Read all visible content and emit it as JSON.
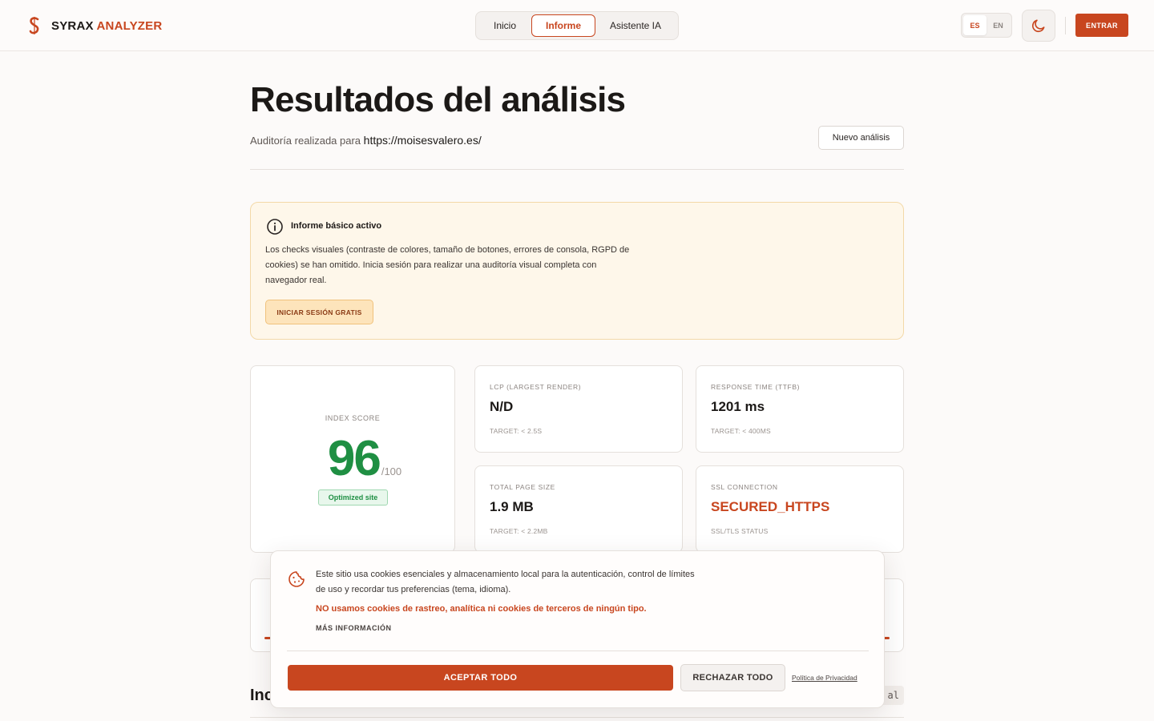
{
  "header": {
    "brand_primary": "SYRAX",
    "brand_accent": "ANALYZER",
    "nav": [
      {
        "label": "Inicio",
        "active": false
      },
      {
        "label": "Informe",
        "active": true
      },
      {
        "label": "Asistente IA",
        "active": false
      }
    ],
    "languages": [
      {
        "label": "ES",
        "active": true
      },
      {
        "label": "EN",
        "active": false
      }
    ],
    "theme_icon": "moon-icon",
    "login_label": "ENTRAR"
  },
  "main": {
    "title": "Resultados del análisis",
    "subtitle_prefix": "Auditoría realizada para",
    "audited_url": "https://moisesvalero.es/",
    "new_analysis_label": "Nuevo análisis"
  },
  "notice": {
    "icon": "info-icon",
    "title": "Informe básico activo",
    "body": "Los checks visuales (contraste de colores, tamaño de botones, errores de consola, RGPD de cookies) se han omitido. Inicia sesión para realizar una auditoría visual completa con navegador real.",
    "button_label": "INICIAR SESIÓN GRATIS"
  },
  "score": {
    "label": "INDEX SCORE",
    "value": "96",
    "max": "/100",
    "badge": "Optimized site"
  },
  "metrics": [
    {
      "label": "LCP (LARGEST RENDER)",
      "value": "N/D",
      "sub": "TARGET: < 2.5S",
      "highlight": false
    },
    {
      "label": "RESPONSE TIME (TTFB)",
      "value": "1201 ms",
      "sub": "TARGET: < 400MS",
      "highlight": false
    },
    {
      "label": "TOTAL PAGE SIZE",
      "value": "1.9 MB",
      "sub": "TARGET: < 2.2MB",
      "highlight": false
    },
    {
      "label": "SSL CONNECTION",
      "value": "SECURED_HTTPS",
      "sub": "SSL/TLS STATUS",
      "highlight": true
    }
  ],
  "lower": {
    "section_title_partial": "Inc",
    "tag_partial": "al"
  },
  "cookie": {
    "icon": "cookie-icon",
    "text": "Este sitio usa cookies esenciales y almacenamiento local para la autenticación, control de límites de uso y recordar tus preferencias (tema, idioma).",
    "warning": "NO usamos cookies de rastreo, analítica ni cookies de terceros de ningún tipo.",
    "more_info": "MÁS INFORMACIÓN",
    "accept_label": "ACEPTAR TODO",
    "reject_label": "RECHAZAR TODO",
    "privacy_label": "Política de Privacidad"
  },
  "colors": {
    "accent": "#c8461f",
    "score_green": "#1f8f43",
    "notice_bg": "#fef7ea"
  }
}
